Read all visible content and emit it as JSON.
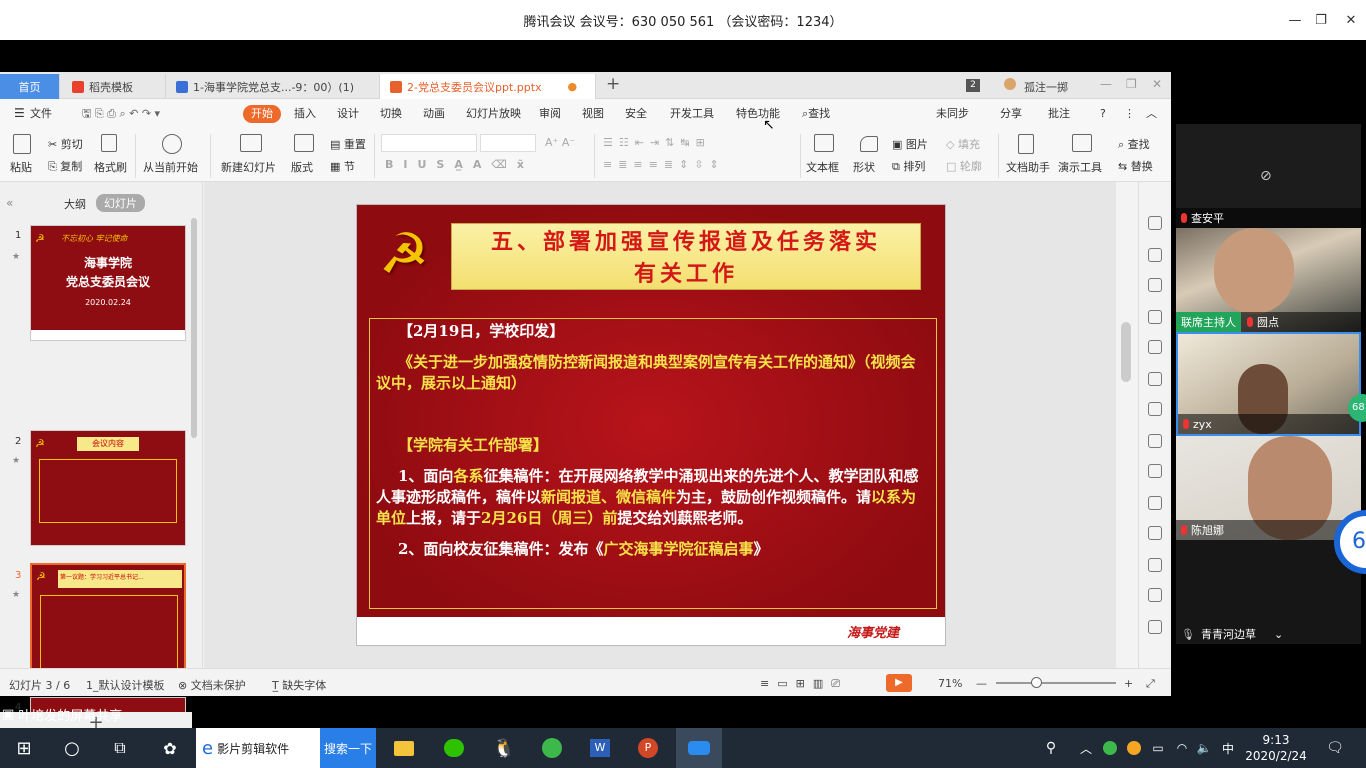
{
  "meeting": {
    "title": "腾讯会议 会议号：630 050 561  （会议密码：1234）",
    "share_label": "叶培发的屏幕共享"
  },
  "participants": [
    {
      "name": "查安平"
    },
    {
      "name": "囫点",
      "role": "联席主持人"
    },
    {
      "name": "zyx"
    },
    {
      "name": "陈旭娜"
    },
    {
      "name": "青青河边草"
    }
  ],
  "side_badges": [
    "68",
    "6"
  ],
  "wps": {
    "tabs": [
      {
        "label": "首页"
      },
      {
        "label": "稻壳模板"
      },
      {
        "label": "1-海事学院党总支...-9：00）(1)"
      },
      {
        "label": "2-党总支委员会议ppt.pptx"
      }
    ],
    "tab_count": "2",
    "user_name": "孤注一掷",
    "menu": [
      "文件",
      "开始",
      "插入",
      "设计",
      "切换",
      "动画",
      "幻灯片放映",
      "审阅",
      "视图",
      "安全",
      "开发工具",
      "特色功能",
      "查找"
    ],
    "menu_right": [
      "未同步",
      "分享",
      "批注"
    ],
    "ribbon": {
      "paste": "粘贴",
      "cut": "剪切",
      "copy": "复制",
      "format_painter": "格式刷",
      "from_current": "从当前开始",
      "new_slide": "新建幻灯片",
      "layout": "版式",
      "reset": "重置",
      "section": "节",
      "textbox": "文本框",
      "shape": "形状",
      "picture": "图片",
      "arrange": "排列",
      "fill": "填充",
      "outline": "轮廓",
      "doc_assistant": "文档助手",
      "present_tools": "演示工具",
      "find": "查找",
      "replace": "替换"
    },
    "pane_tabs": [
      "大纲",
      "幻灯片"
    ],
    "thumbnails": [
      {
        "num": "1",
        "line1": "不忘初心 牢记使命",
        "title": "海事学院\n党总支委员会议",
        "date": "2020.02.24"
      },
      {
        "num": "2",
        "title": "会议内容"
      },
      {
        "num": "3",
        "title": "第一议题：学习习近平总书记..."
      },
      {
        "num": "4"
      }
    ],
    "status": {
      "slide_pos": "幻灯片 3 / 6",
      "template": "1_默认设计模板",
      "protect": "文档未保护",
      "missing_font": "缺失字体",
      "zoom": "71%"
    }
  },
  "slide": {
    "title_line1": "五、部署加强宣传报道及任务落实",
    "title_line2": "有关工作",
    "p1": "【2月19日，学校印发】",
    "p2": "《关于进一步加强疫情防控新闻报道和典型案例宣传有关工作的通知》（视频会议中，展示以上通知）",
    "p3": "【学院有关工作部署】",
    "p4a": "1、面向",
    "p4b": "各系",
    "p4c": "征集稿件：在开展网络教学中涌现出来的先进个人、教学团队和感人事迹形成稿件，稿件以",
    "p4d": "新闻报道、微信稿件",
    "p4e": "为主，鼓励创作视频稿件。请",
    "p4f": "以系为单位",
    "p4g": "上报，请于",
    "p4h": "2月26日（周三）前",
    "p4i": "提交给刘蕻熙老师。",
    "p5a": "2、面向校友征集稿件：发布《",
    "p5b": "广交海事学院征稿启事",
    "p5c": "》",
    "footer": "海事党建"
  },
  "taskbar": {
    "app1": "影片剪辑软件",
    "search": "搜索一下",
    "time": "9:13",
    "date": "2020/2/24",
    "ime": "中"
  },
  "colors": {
    "accent": "#ee6a2a",
    "slide_red": "#b8141b",
    "gold": "#f7e98a",
    "taskbar": "#1f2a36"
  }
}
